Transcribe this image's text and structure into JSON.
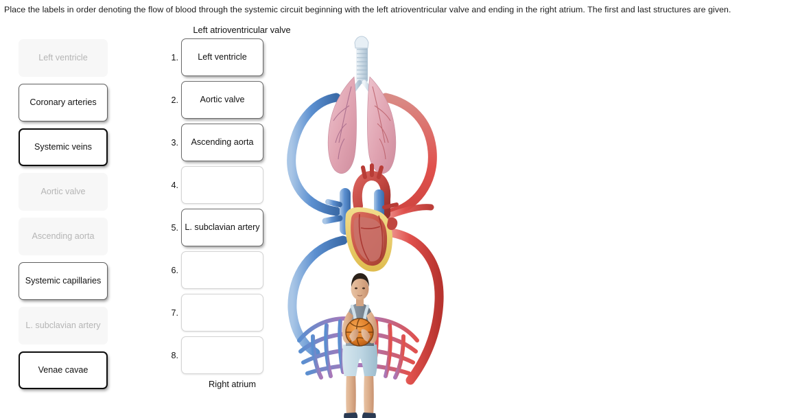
{
  "prompt": {
    "text": "Place the labels in order denoting the flow of blood through the systemic circuit beginning with the left atrioventricular valve and ending in the right atrium. The first and last structures are given."
  },
  "label_bank": {
    "name": "draggable-label-bank",
    "items": [
      {
        "label": "Left ventricle",
        "state": "used"
      },
      {
        "label": "Coronary arteries",
        "state": "active"
      },
      {
        "label": "Systemic veins",
        "state": "active-strong"
      },
      {
        "label": "Aortic valve",
        "state": "used"
      },
      {
        "label": "Ascending aorta",
        "state": "used"
      },
      {
        "label": "Systemic capillaries",
        "state": "active"
      },
      {
        "label": "L. subclavian artery",
        "state": "used"
      },
      {
        "label": "Venae cavae",
        "state": "active-strong"
      }
    ]
  },
  "answer_column": {
    "caption_top": "Left atrioventricular valve",
    "caption_bottom": "Right atrium",
    "slots": [
      {
        "number": "1.",
        "value": "Left ventricle",
        "filled": true
      },
      {
        "number": "2.",
        "value": "Aortic valve",
        "filled": true
      },
      {
        "number": "3.",
        "value": "Ascending aorta",
        "filled": true
      },
      {
        "number": "4.",
        "value": "",
        "filled": false
      },
      {
        "number": "5.",
        "value": "L. subclavian artery",
        "filled": true
      },
      {
        "number": "6.",
        "value": "",
        "filled": false
      },
      {
        "number": "7.",
        "value": "",
        "filled": false
      },
      {
        "number": "8.",
        "value": "",
        "filled": false
      }
    ]
  },
  "figure": {
    "name": "circulatory-system-illustration",
    "parts": [
      "trachea",
      "lungs",
      "heart",
      "pulmonary-vessels",
      "aorta",
      "vena-cava",
      "systemic-capillary-bed",
      "person-with-basketball"
    ],
    "colors": {
      "oxygenated": "#e0514d",
      "deoxygenated": "#5b8fd0",
      "capillary": "#a978b8",
      "lung": "#e3a7b4",
      "heart_muscle": "#c0453f",
      "cardiac_fat": "#eccd62",
      "trachea": "#ccdbe6"
    }
  }
}
